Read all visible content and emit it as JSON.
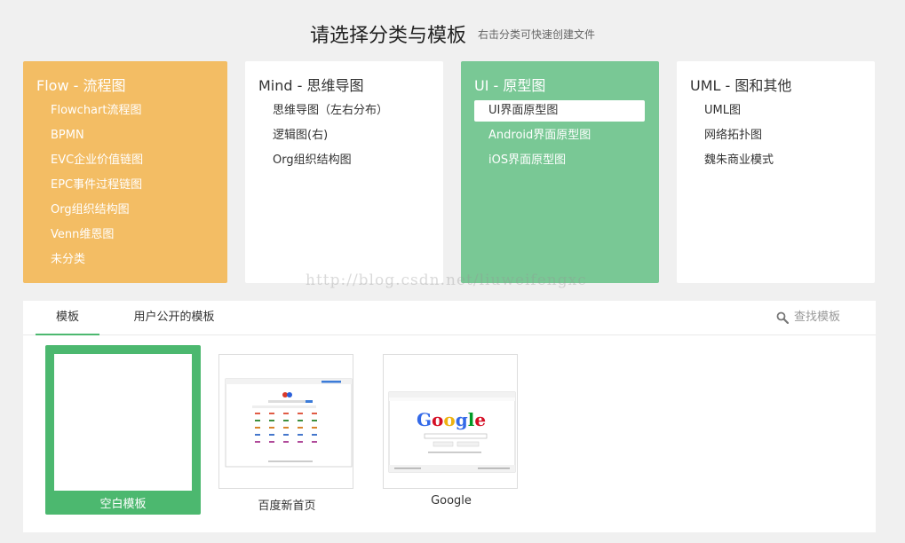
{
  "header": {
    "title": "请选择分类与模板",
    "subtitle": "右击分类可快速创建文件"
  },
  "categories": [
    {
      "title": "Flow - 流程图",
      "items": [
        "Flowchart流程图",
        "BPMN",
        "EVC企业价值链图",
        "EPC事件过程链图",
        "Org组织结构图",
        "Venn维恩图",
        "未分类"
      ]
    },
    {
      "title": "Mind - 思维导图",
      "items": [
        "思维导图（左右分布）",
        "逻辑图(右)",
        "Org组织结构图"
      ]
    },
    {
      "title": "UI - 原型图",
      "items": [
        "UI界面原型图",
        "Android界面原型图",
        "iOS界面原型图"
      ],
      "selected_item": "UI界面原型图"
    },
    {
      "title": "UML - 图和其他",
      "items": [
        "UML图",
        "网络拓扑图",
        "魏朱商业模式"
      ]
    }
  ],
  "watermark": "http://blog.csdn.net/liuweifengxc",
  "tabs": [
    "模板",
    "用户公开的模板"
  ],
  "active_tab": "模板",
  "search": {
    "label": "查找模板",
    "icon": "search-icon"
  },
  "templates": [
    {
      "label": "空白模板",
      "selected": true
    },
    {
      "label": "百度新首页",
      "selected": false
    },
    {
      "label": "Google",
      "selected": false
    }
  ],
  "colors": {
    "flow": "#f3bd64",
    "ui": "#79c895",
    "accent_green": "#4cb86f",
    "background": "#f0f0f0"
  }
}
